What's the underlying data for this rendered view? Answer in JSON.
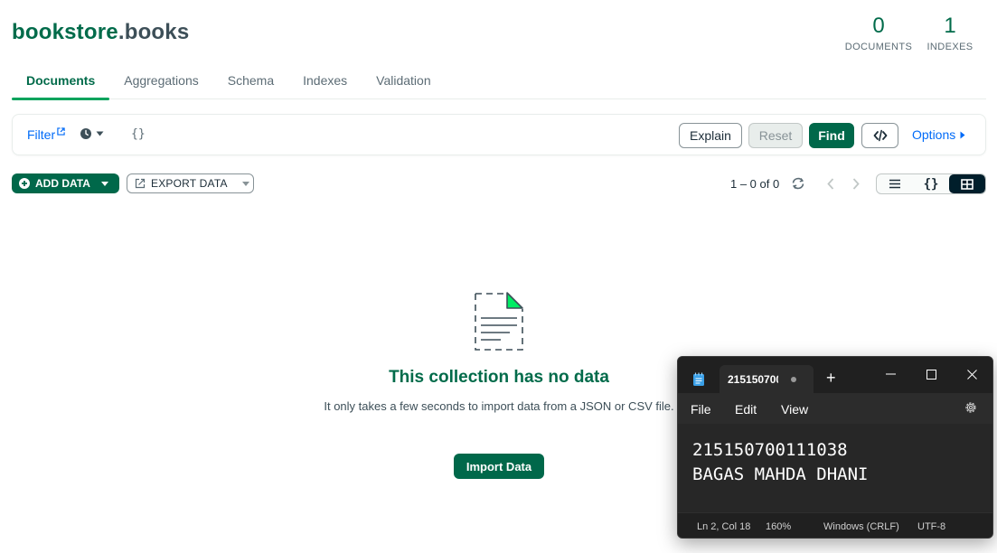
{
  "header": {
    "db_name": "bookstore",
    "dot": ".",
    "collection_name": "books",
    "documents_count": "0",
    "documents_label": "DOCUMENTS",
    "indexes_count": "1",
    "indexes_label": "INDEXES"
  },
  "tabs": [
    {
      "label": "Documents",
      "active": true
    },
    {
      "label": "Aggregations",
      "active": false
    },
    {
      "label": "Schema",
      "active": false
    },
    {
      "label": "Indexes",
      "active": false
    },
    {
      "label": "Validation",
      "active": false
    }
  ],
  "query_bar": {
    "filter_label": "Filter",
    "filter_value": "{}",
    "explain_label": "Explain",
    "reset_label": "Reset",
    "find_label": "Find",
    "options_label": "Options"
  },
  "toolbar": {
    "add_data_label": "ADD DATA",
    "export_data_label": "EXPORT DATA",
    "pagination_text": "1 – 0 of 0",
    "active_view": "table"
  },
  "empty_state": {
    "title": "This collection has no data",
    "description": "It only takes a few seconds to import data from a JSON or CSV file.",
    "import_label": "Import Data"
  },
  "notepad": {
    "tab_title": "215150700",
    "menu": [
      "File",
      "Edit",
      "View"
    ],
    "text": "215150700111038\nBAGAS MAHDA DHANI",
    "status": {
      "position": "Ln 2, Col 18",
      "zoom": "160%",
      "line_ending": "Windows (CRLF)",
      "encoding": "UTF-8"
    }
  },
  "colors": {
    "brand_green": "#00684a",
    "title_green": "#016b4a",
    "tab_underline": "#00a35c",
    "link_blue": "#016bf8",
    "notepad_bg": "#202020"
  },
  "icons": [
    "external-link-icon",
    "history-clock-icon",
    "caret-down-icon",
    "code-icon",
    "caret-right-icon",
    "plus-circle-icon",
    "export-icon",
    "refresh-icon",
    "chevron-left-icon",
    "chevron-right-icon",
    "list-view-icon",
    "json-view-icon",
    "table-view-icon",
    "empty-document-icon",
    "notepad-icon",
    "minimize-icon",
    "maximize-icon",
    "close-icon",
    "settings-gear-icon"
  ]
}
